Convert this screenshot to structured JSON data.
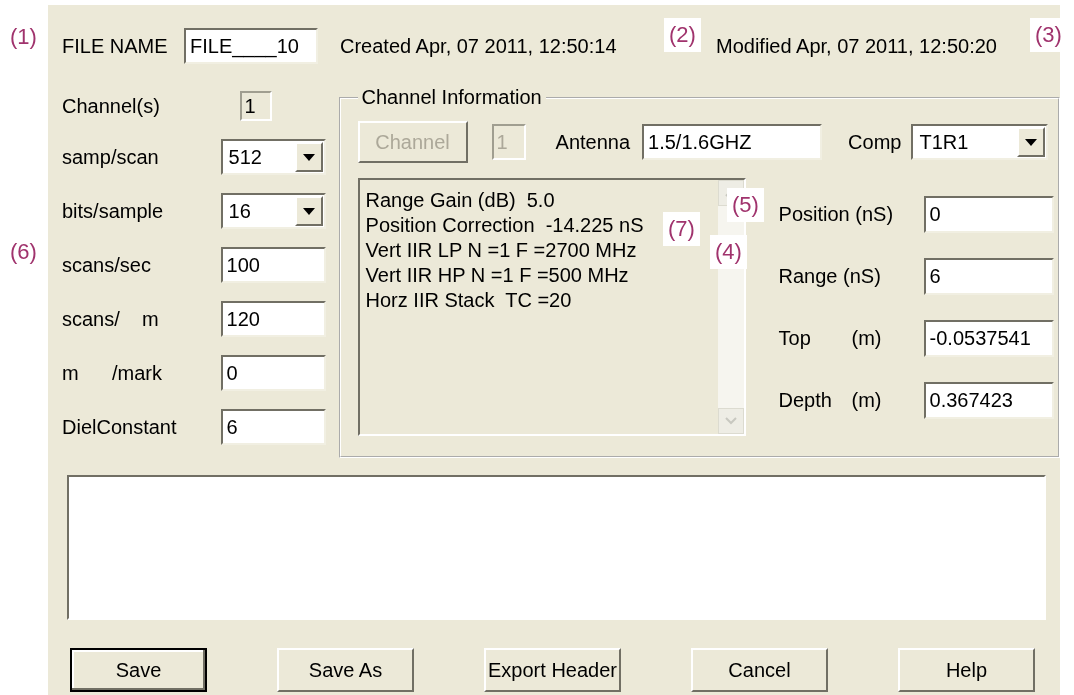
{
  "file_name": {
    "label": "FILE NAME",
    "value": "FILE____10"
  },
  "created": "Created Apr, 07 2011, 12:50:14",
  "modified": "Modified Apr, 07 2011, 12:50:20",
  "fields": [
    {
      "label": "Channel(s)",
      "value": "1",
      "kind": "readonly"
    },
    {
      "label": "samp/scan",
      "value": "512",
      "kind": "select"
    },
    {
      "label": "bits/sample",
      "value": "16",
      "kind": "select"
    },
    {
      "label": "scans/sec",
      "value": "100",
      "kind": "input"
    },
    {
      "label": "scans/    m",
      "value": "120",
      "kind": "input"
    },
    {
      "label": "m      /mark",
      "value": "0",
      "kind": "input"
    },
    {
      "label": "DielConstant",
      "value": "6",
      "kind": "input"
    }
  ],
  "channel_info": {
    "title": "Channel Information",
    "channel_button": {
      "label": "Channel",
      "disabled": true
    },
    "channel_number": {
      "value": "1",
      "disabled": true
    },
    "antenna": {
      "label": "Antenna",
      "value": "1.5/1.6GHZ"
    },
    "comp": {
      "label": "Comp",
      "value": "T1R1"
    },
    "info_lines": [
      "Range Gain (dB)  5.0",
      "Position Correction  -14.225 nS",
      "Vert IIR LP N =1 F =2700 MHz",
      "Vert IIR HP N =1 F =500 MHz",
      "Horz IIR Stack  TC =20"
    ],
    "fields": [
      {
        "label": "Position (nS)",
        "value": "0"
      },
      {
        "label": "Range (nS)",
        "value": "6"
      },
      {
        "label": "Top",
        "unit": "(m)",
        "value": "-0.0537541"
      },
      {
        "label": "Depth",
        "unit": "(m)",
        "value": "0.367423"
      }
    ]
  },
  "buttons": [
    {
      "label": "Save",
      "default": true
    },
    {
      "label": "Save As",
      "default": false
    },
    {
      "label": "Export Header",
      "default": false
    },
    {
      "label": "Cancel",
      "default": false
    },
    {
      "label": "Help",
      "default": false
    }
  ],
  "callouts": [
    "(1)",
    "(2)",
    "(3)",
    "(4)",
    "(5)",
    "(6)",
    "(7)"
  ]
}
